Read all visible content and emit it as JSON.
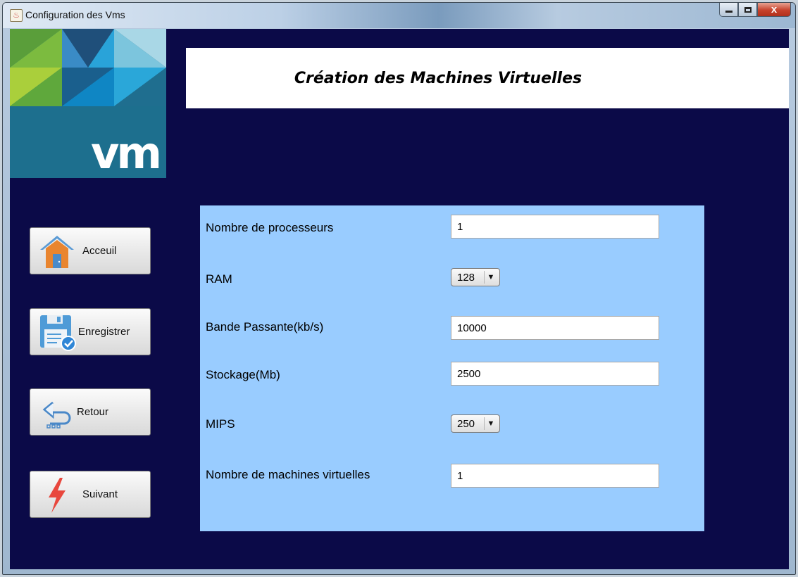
{
  "window": {
    "title": "Configuration des Vms",
    "app_icon": "java-cup-icon",
    "controls": {
      "minimize": "minimize-icon",
      "maximize": "maximize-icon",
      "close": "x"
    }
  },
  "logo": {
    "text": "vm"
  },
  "header": {
    "title": "Création des Machines Virtuelles"
  },
  "sidebar": {
    "buttons": [
      {
        "label": "Acceuil",
        "icon": "home-icon"
      },
      {
        "label": "Enregistrer",
        "icon": "save-icon"
      },
      {
        "label": "Retour",
        "icon": "return-arrow-icon"
      },
      {
        "label": "Suivant",
        "icon": "lightning-icon"
      }
    ]
  },
  "form": {
    "processors": {
      "label": "Nombre de processeurs",
      "value": "1"
    },
    "ram": {
      "label": "RAM",
      "value": "128"
    },
    "bandwidth": {
      "label": "Bande Passante(kb/s)",
      "value": "10000"
    },
    "storage": {
      "label": "Stockage(Mb)",
      "value": "2500"
    },
    "mips": {
      "label": "MIPS",
      "value": "250"
    },
    "vm_count": {
      "label": "Nombre de machines virtuelles",
      "value": "1"
    }
  },
  "colors": {
    "background": "#0b0a48",
    "form_panel": "#99ccff",
    "header_bg": "#ffffff"
  }
}
